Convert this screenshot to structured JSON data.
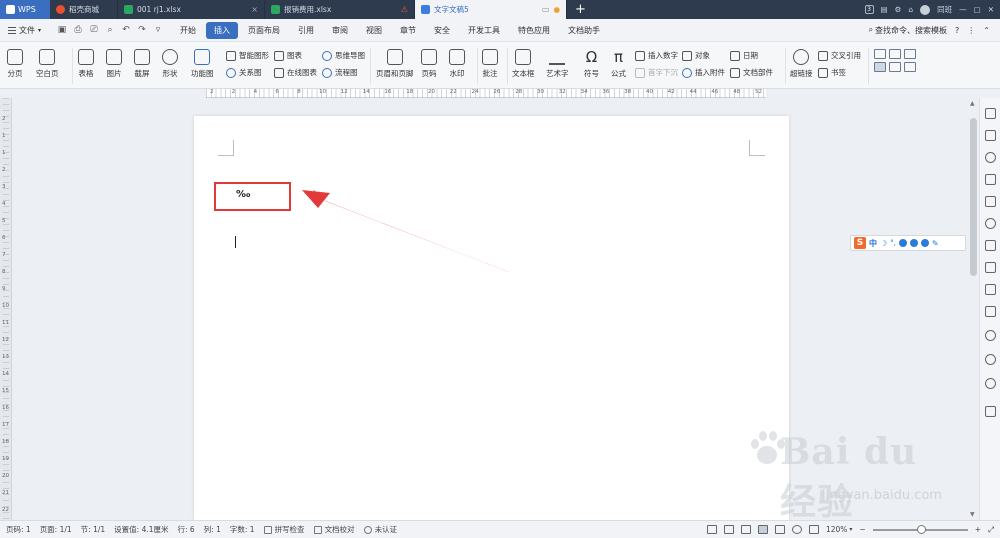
{
  "tabs": {
    "wps": "WPS",
    "items": [
      {
        "label": "稻壳商城",
        "icon": "red"
      },
      {
        "label": "001 rj1.xlsx",
        "icon": "green"
      },
      {
        "label": "报销费用.xlsx",
        "icon": "green"
      },
      {
        "label": "文字文稿5",
        "icon": "blue"
      }
    ],
    "plus": "+",
    "right_label": "同班"
  },
  "menu": {
    "file": "文件",
    "tabs": [
      "开始",
      "插入",
      "页面布局",
      "引用",
      "审阅",
      "视图",
      "章节",
      "安全",
      "开发工具",
      "特色应用",
      "文档助手"
    ],
    "active_tab": "插入",
    "search": "查找命令、搜索模板",
    "help": "?"
  },
  "ribbon": {
    "page_break": "分页",
    "blank_page": "空白页",
    "table": "表格",
    "picture": "图片",
    "screenshot": "截屏",
    "shape": "形状",
    "function_chart": "功能图",
    "smart_shape": "智能图形",
    "chart": "图表",
    "mind_map": "思维导图",
    "relation_chart": "关系图",
    "online_chart": "在线图表",
    "flow_chart": "流程图",
    "header_footer": "页眉和页脚",
    "page_number": "页码",
    "watermark": "水印",
    "comment": "批注",
    "text_box": "文本框",
    "art_text": "艺术字",
    "symbol": "符号",
    "formula": "公式",
    "insert_number": "插入数字",
    "object": "对象",
    "date": "日期",
    "drop_cap": "首字下沉",
    "insert_attachment": "插入附件",
    "doc_parts": "文档部件",
    "hyperlink": "超链接",
    "cross_reference": "交叉引用",
    "bookmark": "书签"
  },
  "ruler": {
    "numbers": [
      "2",
      "2",
      "4",
      "6",
      "8",
      "10",
      "12",
      "14",
      "16",
      "18",
      "20",
      "22",
      "24",
      "26",
      "28",
      "30",
      "32",
      "34",
      "36",
      "38",
      "40",
      "42",
      "44",
      "46",
      "48",
      "52"
    ],
    "v_numbers": [
      "2",
      "1",
      "1",
      "2",
      "3",
      "4",
      "5",
      "6",
      "7",
      "8",
      "9",
      "10",
      "11",
      "12",
      "13",
      "14",
      "15",
      "16",
      "17",
      "18",
      "19",
      "20",
      "21",
      "22",
      "23"
    ]
  },
  "document": {
    "content": "‰"
  },
  "ime": {
    "zh": "中",
    "moon": "☽",
    "dots": "°,"
  },
  "watermark": {
    "brand": "Bai du 经验",
    "url": "jingyan.baidu.com"
  },
  "status": {
    "page": "页码: 1",
    "pages": "页面: 1/1",
    "section": "节: 1/1",
    "setting": "设置值: 4.1厘米",
    "row": "行: 6",
    "col": "列: 1",
    "words": "字数: 1",
    "spell": "拼写检查",
    "proof": "文档校对",
    "cert": "未认证",
    "zoom": "120%",
    "minus": "−",
    "plus": "+"
  }
}
